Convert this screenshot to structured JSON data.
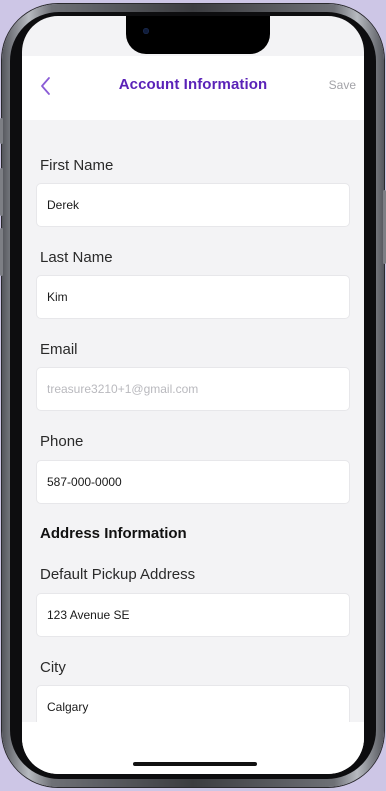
{
  "header": {
    "title": "Account Information",
    "save_label": "Save",
    "back_icon": "chevron-left-icon",
    "accent_color": "#5a22b8"
  },
  "form": {
    "first_name": {
      "label": "First Name",
      "value": "Derek"
    },
    "last_name": {
      "label": "Last Name",
      "value": "Kim"
    },
    "email": {
      "label": "Email",
      "value": "treasure3210+1@gmail.com"
    },
    "phone": {
      "label": "Phone",
      "value": "587-000-0000"
    },
    "address_section_title": "Address Information",
    "pickup_address": {
      "label": "Default Pickup Address",
      "value": "123 Avenue SE"
    },
    "city": {
      "label": "City",
      "value": "Calgary"
    }
  }
}
